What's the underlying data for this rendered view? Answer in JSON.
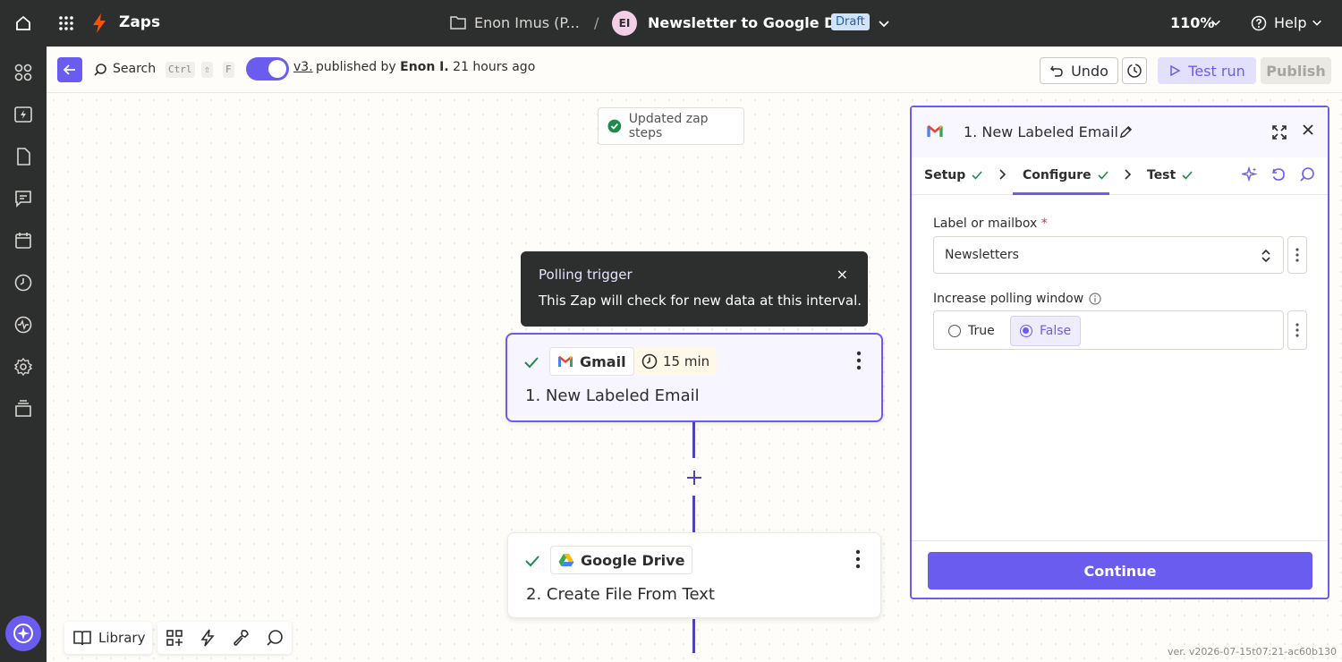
{
  "topbar": {
    "app_name": "Zaps",
    "folder_name": "Enon Imus (P...",
    "separator": "/",
    "avatar_initials": "EI",
    "zap_name": "Newsletter to Google Drive",
    "status_badge": "Draft",
    "zoom": "110%",
    "help": "Help"
  },
  "toolbar": {
    "search_label": "Search",
    "shortcut_keys": [
      "Ctrl",
      "⇧",
      "F"
    ],
    "version_link": "v3.",
    "published_prefix": "published by",
    "published_by": "Enon I.",
    "published_time": "21 hours ago",
    "undo_label": "Undo",
    "test_run_label": "Test run",
    "publish_label": "Publish"
  },
  "canvas": {
    "toast": "Updated zap steps",
    "tooltip": {
      "title": "Polling trigger",
      "body": "This Zap will check for new data at this interval.",
      "close": "×"
    },
    "steps": [
      {
        "app": "Gmail",
        "interval": "15 min",
        "title": "1. New Labeled Email"
      },
      {
        "app": "Google Drive",
        "title": "2. Create File From Text"
      }
    ]
  },
  "bottom": {
    "library_label": "Library",
    "version_text": "ver. v2026-07-15t07:21-ac60b130"
  },
  "panel": {
    "title": "1. New Labeled Email",
    "tabs": [
      {
        "label": "Setup"
      },
      {
        "label": "Configure"
      },
      {
        "label": "Test"
      }
    ],
    "active_tab": "Configure",
    "fields": {
      "label_mailbox": {
        "label": "Label or mailbox",
        "required_mark": "*",
        "value": "Newsletters"
      },
      "polling_window": {
        "label": "Increase polling window",
        "options": [
          "True",
          "False"
        ],
        "selected": "False"
      }
    },
    "continue_label": "Continue"
  },
  "colors": {
    "accent": "#6b5cf0",
    "topbar_bg": "#2d2e2e",
    "zapier_orange": "#ff4f00",
    "success_green": "#1f8a4c"
  }
}
